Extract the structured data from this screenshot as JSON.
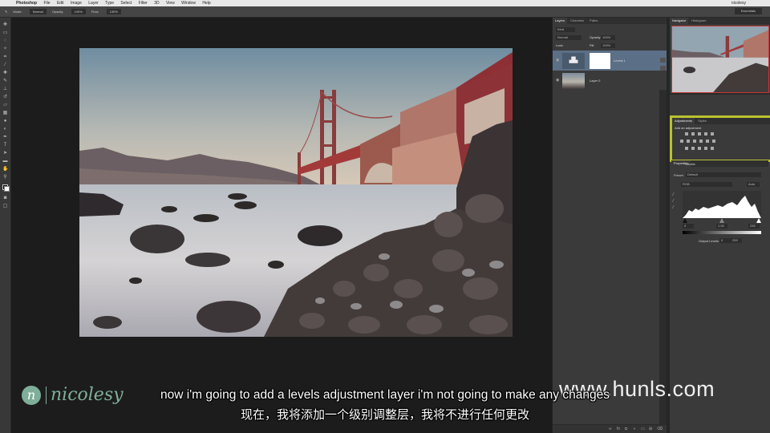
{
  "menubar": {
    "app_name": "Photoshop",
    "items": [
      "File",
      "Edit",
      "Image",
      "Layer",
      "Type",
      "Select",
      "Filter",
      "3D",
      "View",
      "Window",
      "Help"
    ],
    "user": "nicolesy"
  },
  "options_bar": {
    "mode_label": "Mode:",
    "mode_value": "Normal",
    "opacity_label": "Opacity:",
    "opacity_value": "100%",
    "flow_label": "Flow:",
    "flow_value": "100%",
    "workspace": "Essentials"
  },
  "layers_panel": {
    "tabs": [
      "Layers",
      "Channels",
      "Paths"
    ],
    "filter_kind": "Kind",
    "blend_mode": "Normal",
    "opacity_label": "Opacity:",
    "opacity_value": "100%",
    "fill_label": "Fill:",
    "fill_value": "100%",
    "lock_label": "Lock:",
    "layers": [
      {
        "name": "Levels 1",
        "selected": true
      },
      {
        "name": "Layer 0",
        "selected": false
      }
    ]
  },
  "right_panel": {
    "nav_tabs": [
      "Navigator",
      "Histogram"
    ],
    "adj_tabs": [
      "Adjustments",
      "Styles"
    ],
    "adj_title": "Add an adjustment",
    "props_tab": "Properties",
    "props_title": "Levels",
    "preset_label": "Preset:",
    "preset_value": "Default",
    "channel_value": "RGB",
    "auto_label": "Auto",
    "input_values": [
      "0",
      "1.00",
      "255"
    ],
    "output_label": "Output Levels:",
    "output_values": [
      "0",
      "255"
    ]
  },
  "subtitles": {
    "english": "now i'm going to add a levels adjustment layer i'm not going to make any changes",
    "chinese": "现在，我将添加一个级别调整层，我将不进行任何更改"
  },
  "watermark": "www.hunls.com",
  "logo_text": "nicolesy",
  "colors": {
    "highlight_box": "#b9c230",
    "bridge_red": "#a33a3a",
    "panel_bg": "#3a3a3a"
  }
}
